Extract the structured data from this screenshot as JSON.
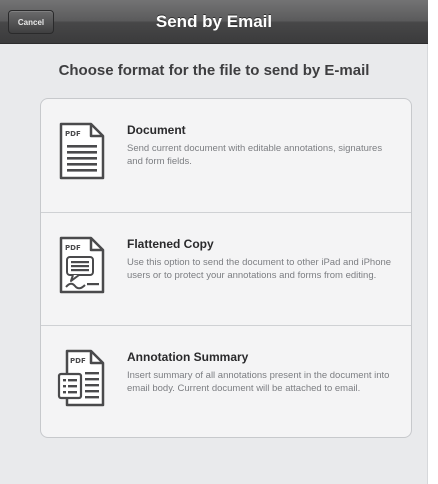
{
  "navbar": {
    "cancel_label": "Cancel",
    "title": "Send by Email"
  },
  "heading": "Choose format for the file to send by E-mail",
  "options": [
    {
      "icon": "pdf-document-icon",
      "badge": "PDF",
      "title": "Document",
      "description": "Send current document with editable annotations, signatures and form fields."
    },
    {
      "icon": "pdf-flattened-copy-icon",
      "badge": "PDF",
      "title": "Flattened Copy",
      "description": "Use this option to send the document to other iPad and iPhone users or to protect your annotations and forms from editing."
    },
    {
      "icon": "pdf-annotation-summary-icon",
      "badge": "PDF",
      "title": "Annotation Summary",
      "description": "Insert summary of all annotations present in the document into email body. Current document will be attached to email."
    }
  ],
  "colors": {
    "navbar": "#4a4a4b",
    "sheet_background": "#e9eaec",
    "option_background": "#f4f4f5"
  }
}
